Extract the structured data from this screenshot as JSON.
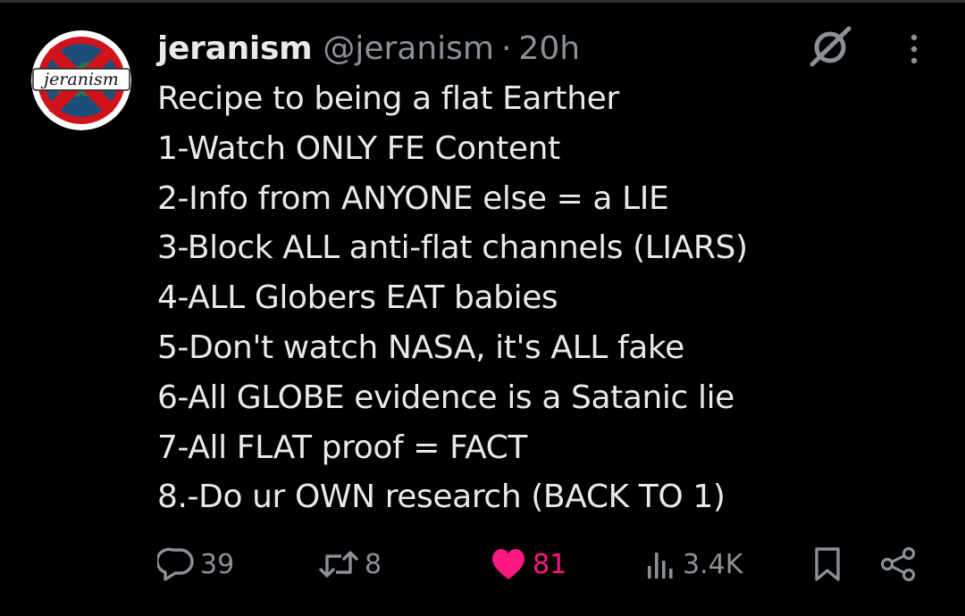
{
  "tweet": {
    "author": {
      "display_name": "jeranism",
      "handle": "@jeranism",
      "avatar_text": "jeranism"
    },
    "separator": "·",
    "time": "20h",
    "lines": [
      "Recipe to being a flat Earther",
      "1-Watch ONLY FE Content",
      "2-Info from ANYONE else = a LIE",
      "3-Block ALL anti-flat channels (LIARS)",
      "4-ALL Globers EAT babies",
      "5-Don't watch NASA, it's ALL fake",
      "6-All GLOBE evidence is a Satanic lie",
      "7-All FLAT proof = FACT",
      "8.-Do ur OWN research (BACK TO 1)"
    ]
  },
  "actions": {
    "replies": "39",
    "reposts": "8",
    "likes": "81",
    "views": "3.4K"
  },
  "icons": {
    "reply": "reply-icon",
    "repost": "repost-icon",
    "like": "heart-icon",
    "views": "views-icon",
    "bookmark": "bookmark-icon",
    "share": "share-icon",
    "grok": "grok-icon",
    "more": "more-icon"
  },
  "colors": {
    "background": "#000000",
    "text": "#e7e9ea",
    "muted": "#8b9096",
    "like": "#f91880"
  }
}
